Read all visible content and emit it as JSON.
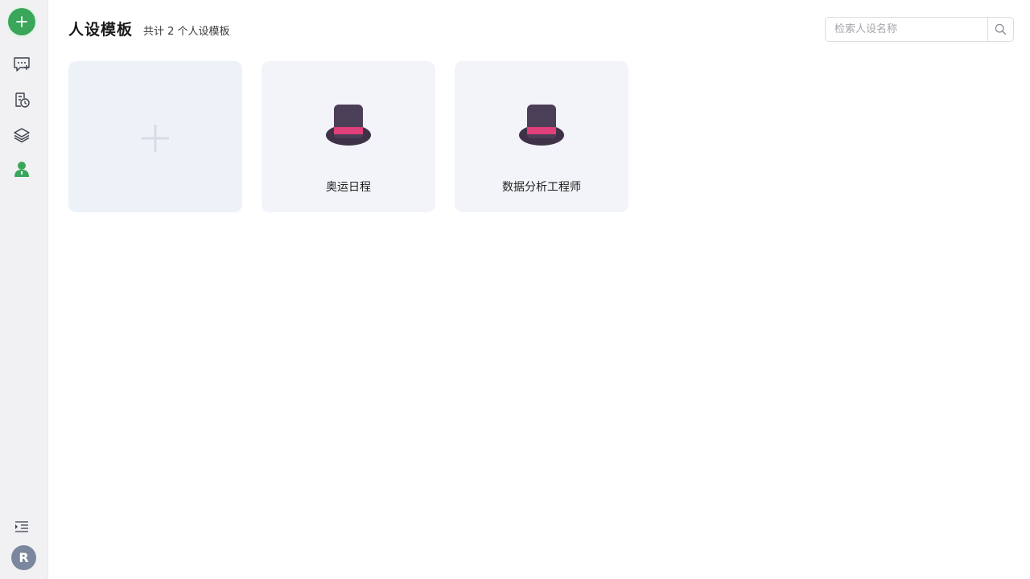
{
  "header": {
    "title": "人设模板",
    "count_text": "共计 2 个人设模板"
  },
  "search": {
    "placeholder": "检索人设名称",
    "value": ""
  },
  "sidebar": {
    "items": [
      {
        "icon": "chat-add-icon"
      },
      {
        "icon": "history-icon"
      },
      {
        "icon": "layers-icon"
      },
      {
        "icon": "persona-icon",
        "active": true
      }
    ],
    "avatar_initial": "R"
  },
  "cards": [
    {
      "name": "奥运日程",
      "icon": "top-hat-icon"
    },
    {
      "name": "数据分析工程师",
      "icon": "top-hat-icon"
    }
  ],
  "colors": {
    "accent": "#3aa65a",
    "sidebar_bg": "#f1f1f4",
    "card_bg": "#f2f4f9",
    "avatar_bg": "#7b879e"
  }
}
